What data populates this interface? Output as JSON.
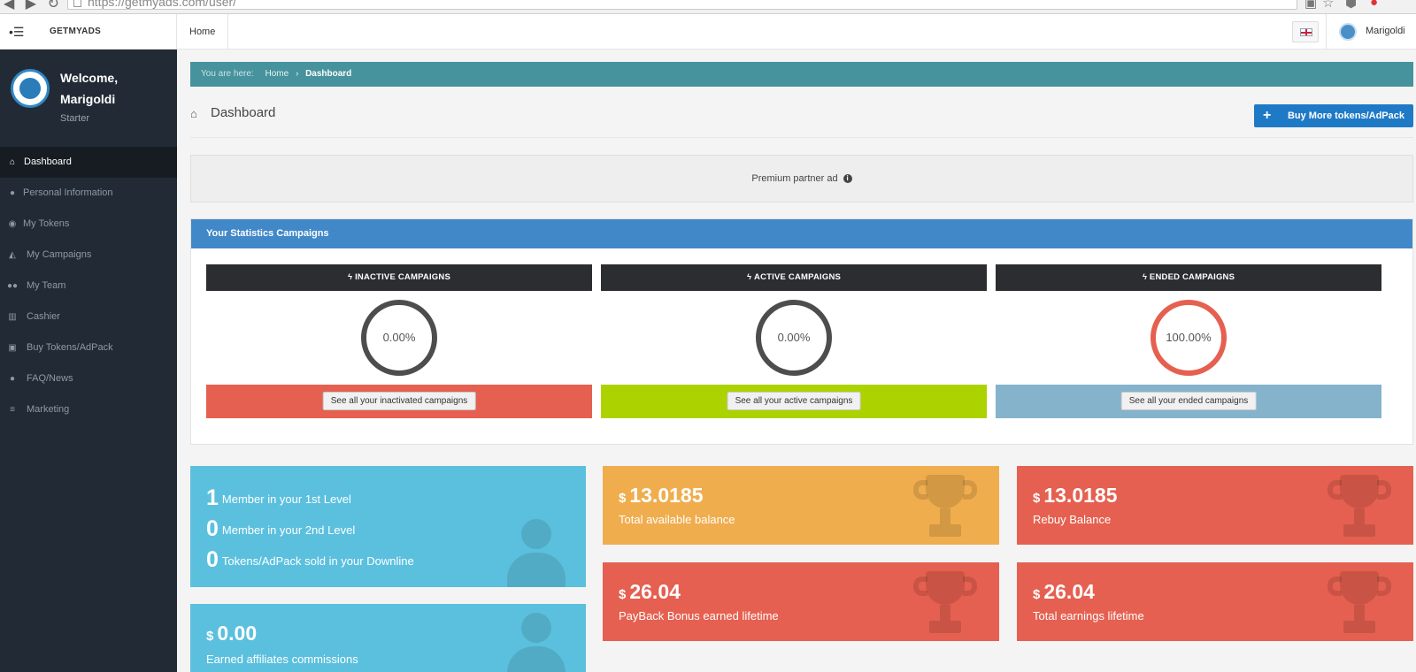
{
  "browser": {
    "url": "https://getmyads.com/user/"
  },
  "topbar": {
    "brand": "GETMYADS",
    "home": "Home",
    "username": "Marigoldi"
  },
  "sidebar": {
    "welcome": "Welcome, Marigoldi",
    "role": "Starter",
    "items": [
      {
        "label": "Dashboard",
        "icon": "home-icon"
      },
      {
        "label": "Personal Information",
        "icon": "user-icon"
      },
      {
        "label": "My Tokens",
        "icon": "dot-circle-icon"
      },
      {
        "label": "My Campaigns",
        "icon": "area-chart-icon"
      },
      {
        "label": "My Team",
        "icon": "users-icon"
      },
      {
        "label": "Cashier",
        "icon": "bank-icon"
      },
      {
        "label": "Buy Tokens/AdPack",
        "icon": "money-icon"
      },
      {
        "label": "FAQ/News",
        "icon": "info-icon"
      },
      {
        "label": "Marketing",
        "icon": "bars-icon"
      }
    ]
  },
  "breadcrumb": {
    "prefix": "You are here:",
    "home": "Home",
    "current": "Dashboard"
  },
  "page": {
    "title": "Dashboard",
    "buy_button": "Buy More tokens/AdPack"
  },
  "ad": {
    "text": "Premium partner ad"
  },
  "stats": {
    "title": "Your Statistics Campaigns",
    "campaigns": [
      {
        "header": "INACTIVE CAMPAIGNS",
        "percent": "0.00%",
        "button": "See all your inactivated campaigns",
        "footer_color": "#e56050",
        "ring_color": "#4d4d4d"
      },
      {
        "header": "ACTIVE CAMPAIGNS",
        "percent": "0.00%",
        "button": "See all your active campaigns",
        "footer_color": "#acd300",
        "ring_color": "#4d4d4d"
      },
      {
        "header": "ENDED CAMPAIGNS",
        "percent": "100.00%",
        "button": "See all your ended campaigns",
        "footer_color": "#85b3cc",
        "ring_color": "#e56050"
      }
    ]
  },
  "team": {
    "lines": [
      {
        "count": "1",
        "text": "Member in your 1st Level"
      },
      {
        "count": "0",
        "text": "Member in your 2nd Level"
      },
      {
        "count": "0",
        "text": "Tokens/AdPack sold in your Downline"
      }
    ]
  },
  "affiliates": {
    "currency": "$",
    "amount": "0.00",
    "label": "Earned affiliates commissions"
  },
  "balances": [
    {
      "currency": "$",
      "amount": "13.0185",
      "label": "Total available balance"
    },
    {
      "currency": "$",
      "amount": "13.0185",
      "label": "Rebuy Balance"
    },
    {
      "currency": "$",
      "amount": "26.04",
      "label": "PayBack Bonus earned lifetime"
    },
    {
      "currency": "$",
      "amount": "26.04",
      "label": "Total earnings lifetime"
    }
  ],
  "colors": {
    "sidebar": "#222b35",
    "breadcrumb": "#46929d",
    "panel_header": "#4188c8",
    "primary_button": "#1f7ac6",
    "tile_blue": "#5bc0de",
    "tile_orange": "#f0ad4e",
    "tile_red": "#e56050"
  }
}
